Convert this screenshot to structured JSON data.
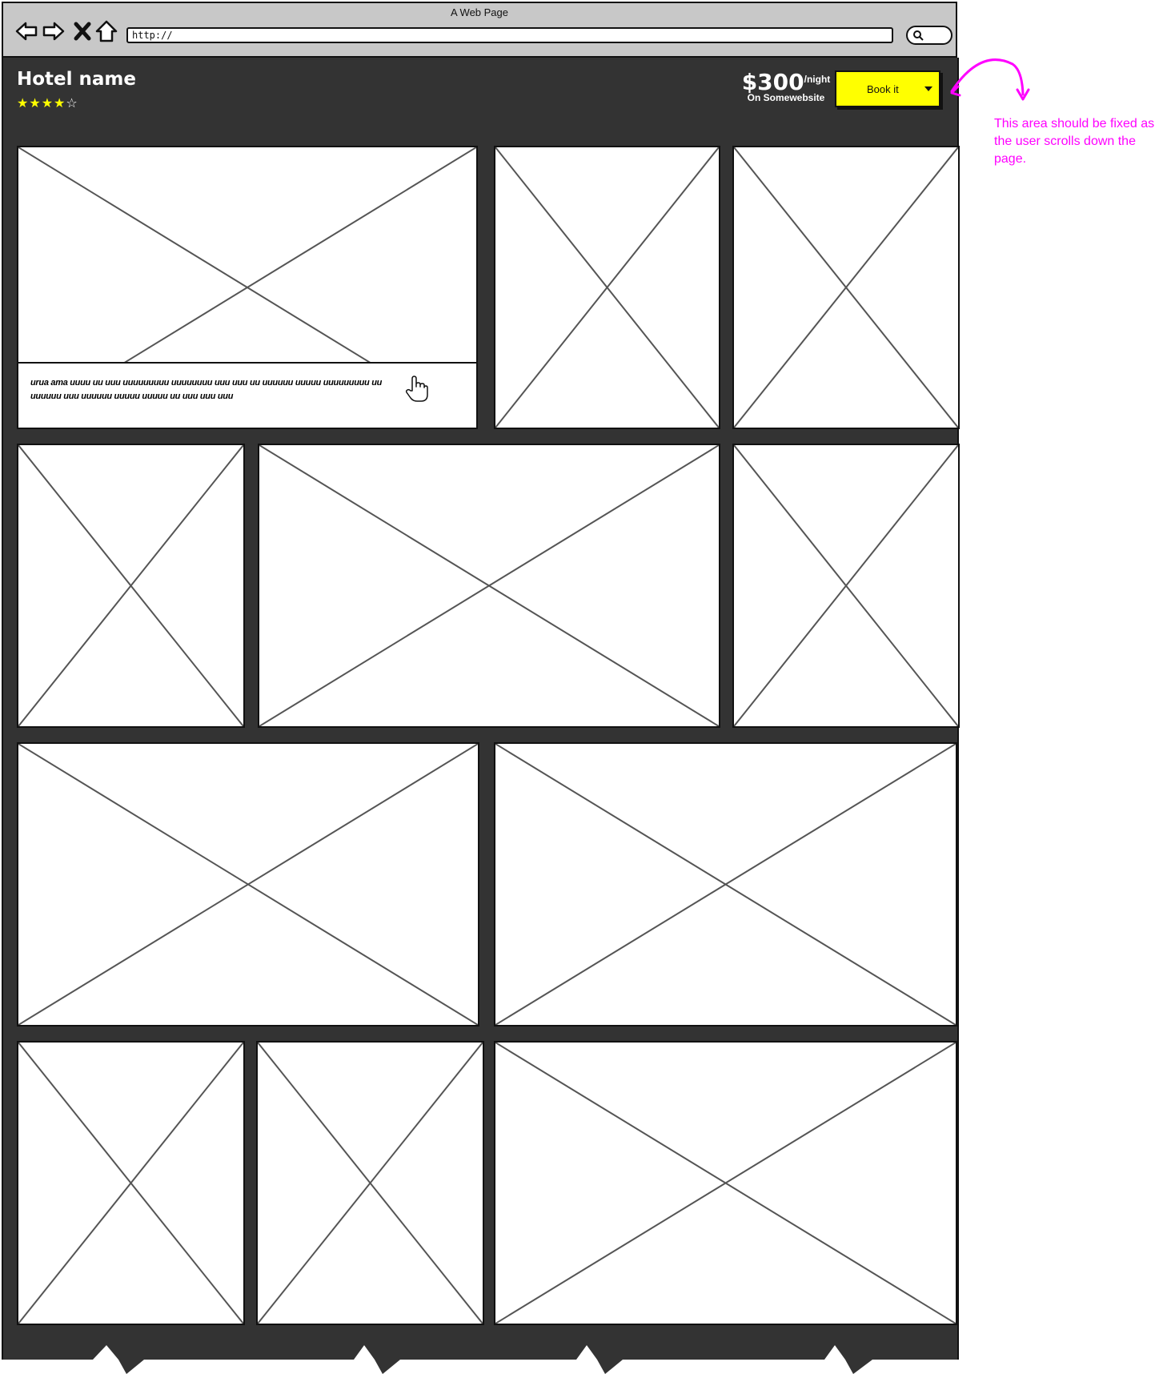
{
  "browser": {
    "window_title": "A Web Page",
    "url": "http://"
  },
  "hotel": {
    "name": "Hotel name",
    "rating": 4,
    "rating_max": 5,
    "price": "$300",
    "price_unit": "/night",
    "provider": "On Somewebsite",
    "book_label": "Book it"
  },
  "gallery": {
    "caption": "urua ama uuuu uu uuu uuuuuuuuu uuuuuuuu uuu uuu uu uuuuuu uuuuu uuuuuuuuu uu uuuuuu uuu uuuuuu uuuuu uuuuu uu uuu uuu uuu"
  },
  "annotation": {
    "note": "This area should be fixed as the user scrolls down the page.",
    "color": "#ff00ff"
  },
  "colors": {
    "page_bg": "#333333",
    "accent": "#ffff00",
    "star": "#ffff00"
  }
}
